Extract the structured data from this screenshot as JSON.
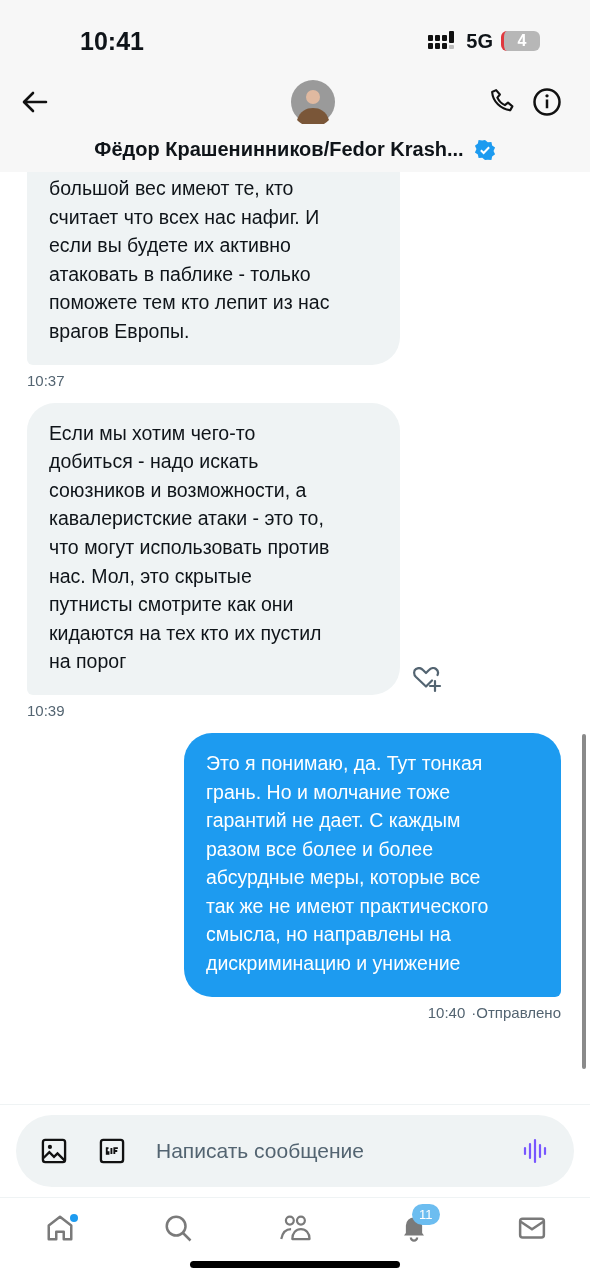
{
  "status_bar": {
    "time": "10:41",
    "network": "5G",
    "battery": "4"
  },
  "header": {
    "name": "Фёдор Крашенинников/Fedor Krash...",
    "verified": true
  },
  "messages": [
    {
      "kind": "received",
      "lines": [
        "большой вес имеют те, кто",
        "считает что всех нас нафиг. И",
        "если вы будете их активно",
        "атаковать в паблике - только",
        "поможете тем кто лепит из нас",
        "врагов Европы."
      ],
      "time": "10:37",
      "like_button": false
    },
    {
      "kind": "received",
      "lines": [
        "Если мы хотим чего-то",
        "добиться - надо искать",
        "союзников и возможности, а",
        "кавалеристские атаки - это то,",
        "что могут использовать против",
        "нас. Мол, это скрытые",
        "путнисты смотрите как они",
        "кидаются на тех  кто их пустил",
        "на порог"
      ],
      "time": "10:39",
      "like_button": true
    },
    {
      "kind": "sent",
      "lines": [
        "Это я понимаю, да. Тут тонкая",
        "грань. Но и молчание тоже",
        "гарантий не дает. С каждым",
        "разом все более и более",
        "абсурдные меры, которые все",
        "так же не имеют практического",
        "смысла, но направлены на",
        "дискриминацию и унижение"
      ],
      "time": "10:40",
      "status": "·Отправлено",
      "like_button": false
    }
  ],
  "composer": {
    "placeholder": "Написать сообщение"
  },
  "tab_bar": [
    {
      "kind": "home",
      "selected": false,
      "dot": true
    },
    {
      "kind": "search",
      "selected": false,
      "dot": false
    },
    {
      "kind": "people",
      "selected": false,
      "dot": false
    },
    {
      "kind": "bell",
      "selected": false,
      "dot": false,
      "badge": "11"
    },
    {
      "kind": "mail",
      "selected": false,
      "dot": false
    }
  ]
}
